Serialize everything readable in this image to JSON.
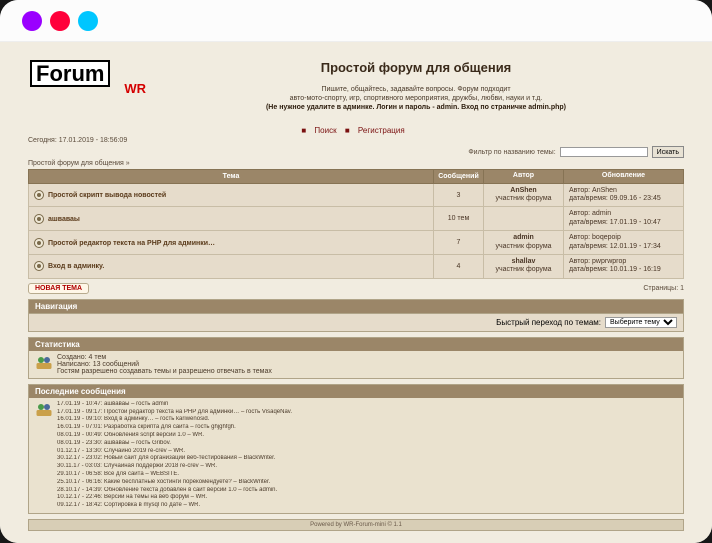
{
  "header": {
    "logo_main": "Forum",
    "logo_sub": "WR",
    "title": "Простой форум для общения",
    "sub1": "Пишите, общайтесь, задавайте вопросы. Форум подходит",
    "sub2": "авто-мото-спорту, игр, спортивного мероприятия, дружбы, любви, науки и т.д.",
    "sub3": "(Не нужное удалите в админке. Логин и пароль - admin. Вход по страничке admin.php)"
  },
  "toplinks": {
    "search": "Поиск",
    "register": "Регистрация"
  },
  "meta": {
    "datetime_label": "Сегодня: 17.01.2019 - 18:56:09",
    "filter_label": "Фильтр по названию темы:",
    "filter_btn": "Искать",
    "breadcrumb": "Простой форум для общения »"
  },
  "columns": {
    "topic": "Тема",
    "messages": "Сообщений",
    "author": "Автор",
    "updated": "Обновление"
  },
  "topics": [
    {
      "title": "Простой скрипт вывода новостей",
      "messages": "3",
      "author_name": "AnShen",
      "author_role": "участник форума",
      "upd_author": "Автор: AnShen",
      "upd_time": "дата/время: 09.09.16 - 23:45"
    },
    {
      "title": "ашваваы",
      "messages": "10 тем",
      "author_name": "",
      "author_role": "",
      "upd_author": "Автор: admin",
      "upd_time": "дата/время: 17.01.19 - 10:47"
    },
    {
      "title": "Простой редактор текста на PHP для админки…",
      "messages": "7",
      "author_name": "admin",
      "author_role": "участник форума",
      "upd_author": "Автор: boqepoip",
      "upd_time": "дата/время: 12.01.19 - 17:34"
    },
    {
      "title": "Вход в админку.",
      "messages": "4",
      "author_name": "shallav",
      "author_role": "участник форума",
      "upd_author": "Автор: pwprwprop",
      "upd_time": "дата/время: 10.01.19 - 16:19"
    }
  ],
  "newtopic": {
    "label": "НОВАЯ ТЕМА"
  },
  "pages": {
    "label": "Страницы: 1"
  },
  "nav_panel": {
    "title": "Навигация",
    "quickjump_label": "Быстрый переход по темам:",
    "quickjump_selected": "Выберите тему"
  },
  "stats": {
    "title": "Статистика",
    "line1": "Создано: 4 тем",
    "line2": "Написано: 13 сообщений",
    "line3": "Гостям разрешено создавать темы и разрешено отвечать в темах"
  },
  "recent": {
    "title": "Последние сообщения",
    "items": [
      "17.01.19 - 10:47: ашваваы – гость admin",
      "17.01.19 - 09:17: Простой редактор текста на PHP для админки… – гость VisaqeNav.",
      "16.01.19 - 09:10: Вход в админку… – гость kariwenosid.",
      "16.01.19 - 07:01: Разработка скрипта для сайта – гость ghjghfgh.",
      "08.01.19 - 00:49: Обновления script версии 1.0 – WR.",
      "08.01.19 - 23:30: ашваваы – гость Gribov.",
      "01.12.17 - 13:30: Случайно 2019 re-crev – WR.",
      "30.12.17 - 23:02: Новый сайт для организации веб-тестирования – BlackWriter.",
      "30.11.17 - 03:03: Случайная поддержи 2018 re-crev – WR.",
      "29.10.17 - 06:58: Все для сайта – WEBSITE.",
      "25.10.17 - 06:16: Какие бесплатные хостинги порекомендуете? – BlackWriter.",
      "28.10.17 - 14:39: Обновление текста добавлен в сайт версии 1.0 – гость admin.",
      "10.12.17 - 22:46: Версии на темы на веб форум – WR.",
      "09.12.17 - 18:42: Сортировка в mysql по дате – WR."
    ]
  },
  "footer": {
    "text": "Powered by WR-Forum-mini © 1.1"
  }
}
